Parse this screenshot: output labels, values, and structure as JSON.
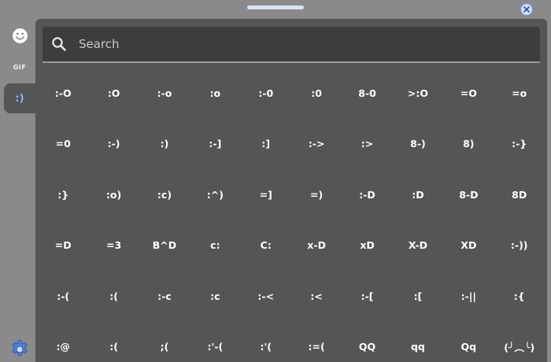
{
  "search": {
    "placeholder": "Search",
    "value": ""
  },
  "sidebar": {
    "items": [
      {
        "name": "emoji",
        "icon": "smiley-icon"
      },
      {
        "name": "gif",
        "label": "GIF"
      },
      {
        "name": "kaomoji",
        "label": ":)",
        "active": true
      }
    ],
    "settings_icon": "gear-icon"
  },
  "colors": {
    "background": "#8a8a8a",
    "panel": "#545556",
    "search_bg": "#3d3d3d",
    "accent": "#8fb4ff",
    "text": "#ffffff"
  },
  "kaomoji": [
    ":-O",
    ":O",
    ":-o",
    ":o",
    ":-0",
    ":0",
    "8-0",
    ">:O",
    "=O",
    "=o",
    "=0",
    ":-)",
    ":)",
    ":-]",
    ":]",
    ":->",
    ":>",
    "8-)",
    "8)",
    ":-}",
    ":}",
    ":o)",
    ":c)",
    ":^)",
    "=]",
    "=)",
    ":-D",
    ":D",
    "8-D",
    "8D",
    "=D",
    "=3",
    "B^D",
    "c:",
    "C:",
    "x-D",
    "xD",
    "X-D",
    "XD",
    ":-))",
    ":-(",
    ":(",
    ":-c",
    ":c",
    ":-<",
    ":<",
    ":-[",
    ":[",
    ":-||",
    ":{",
    ":@",
    ":(",
    ";(",
    ":'-(",
    ":'(",
    ":=(",
    "QQ",
    "qq",
    "Qq",
    "(╯︵╰)"
  ]
}
